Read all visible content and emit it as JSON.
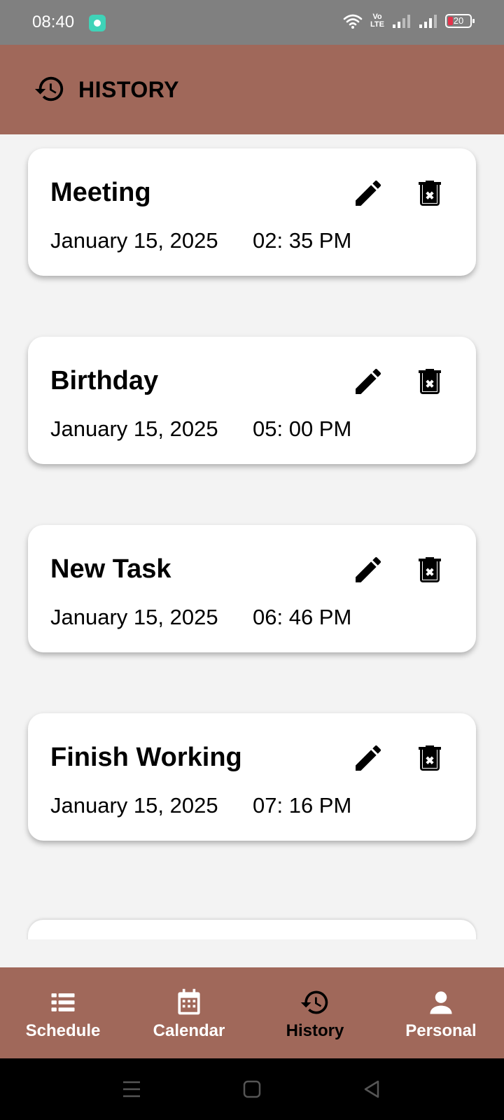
{
  "status_bar": {
    "time": "08:40",
    "volte": "Vo\nLTE",
    "battery": "20"
  },
  "app_bar": {
    "title": "HISTORY",
    "icon": "history-icon"
  },
  "events": [
    {
      "title": "Meeting",
      "date": "January 15, 2025",
      "time": "02: 35 PM"
    },
    {
      "title": "Birthday",
      "date": "January 15, 2025",
      "time": "05: 00 PM"
    },
    {
      "title": "New Task",
      "date": "January 15, 2025",
      "time": "06: 46 PM"
    },
    {
      "title": "Finish Working",
      "date": "January 15, 2025",
      "time": "07: 16 PM"
    }
  ],
  "bottom_nav": [
    {
      "label": "Schedule",
      "icon": "list-icon"
    },
    {
      "label": "Calendar",
      "icon": "calendar-icon"
    },
    {
      "label": "History",
      "icon": "history-icon",
      "active": true
    },
    {
      "label": "Personal",
      "icon": "person-icon"
    }
  ],
  "colors": {
    "accent": "#a0685a",
    "background": "#f3f3f3",
    "status_bar": "#808080"
  }
}
